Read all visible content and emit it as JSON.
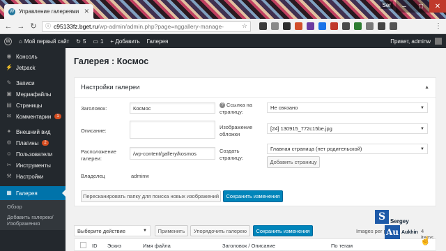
{
  "browser": {
    "tab_title": "Управление галереями",
    "url_host": "c95133fz.bget.ru",
    "url_path": "/wp-admin/admin.php?page=nggallery-manage-",
    "user_badge": "Ser",
    "extension_colors": [
      "#3a3a3a",
      "#8a8a8a",
      "#2c2c2c",
      "#d24e2a",
      "#6a3aa0",
      "#1a73e8",
      "#c0392b",
      "#4a4a4a",
      "#2e7d32",
      "#7a7a7a",
      "#444444",
      "#555555"
    ]
  },
  "adminbar": {
    "site_name": "Мой первый сайт",
    "updates_count": "5",
    "comments_count": "1",
    "add_label": "+ Добавить",
    "gallery_label": "Галерея",
    "greeting": "Привет, adminw"
  },
  "sidebar": {
    "items": [
      {
        "label": "Консоль",
        "icon": "dashboard-icon",
        "glyph": "◉"
      },
      {
        "label": "Jetpack",
        "icon": "jetpack-icon",
        "glyph": "⚡"
      },
      {
        "label": "Записи",
        "icon": "pin-icon",
        "glyph": "✎"
      },
      {
        "label": "Медиафайлы",
        "icon": "media-icon",
        "glyph": "▣"
      },
      {
        "label": "Страницы",
        "icon": "pages-icon",
        "glyph": "▤"
      },
      {
        "label": "Комментарии",
        "icon": "comments-icon",
        "glyph": "✉",
        "badge": "1"
      },
      {
        "label": "Внешний вид",
        "icon": "appearance-icon",
        "glyph": "✦"
      },
      {
        "label": "Плагины",
        "icon": "plugins-icon",
        "glyph": "⚙",
        "badge": "2"
      },
      {
        "label": "Пользователи",
        "icon": "users-icon",
        "glyph": "☺"
      },
      {
        "label": "Инструменты",
        "icon": "tools-icon",
        "glyph": "✂"
      },
      {
        "label": "Настройки",
        "icon": "settings-icon",
        "glyph": "⚒"
      }
    ],
    "active": {
      "label": "Галерея",
      "icon": "gallery-icon",
      "glyph": "▦"
    },
    "submenu": [
      "Обзор",
      "Добавить галерею/ Изображения"
    ]
  },
  "main": {
    "page_title": "Галерея : Космос",
    "settings_title": "Настройки галереи",
    "fields": {
      "title_label": "Заголовок:",
      "title_value": "Космос",
      "description_label": "Описание:",
      "description_value": "",
      "path_label": "Расположение галереи:",
      "path_value": "/wp-content/gallery/kosmos",
      "author_label": "Владелец",
      "author_value": "adminw",
      "link_label": "Ссылка на страницу:",
      "link_value": "Не связано",
      "preview_label": "Изображение обложки",
      "preview_value": "[24] 130915_772c15be.jpg",
      "create_page_label": "Создать страницу:",
      "create_page_value": "Главная страница (нет родительской)",
      "add_page_button": "Добавить страницу"
    },
    "rescan_button": "Пересканировать папку для поиска новых изображений",
    "save_button": "Сохранить изменения",
    "bulk": {
      "action_select": "Выберите действие",
      "apply_button": "Применить",
      "sort_button": "Упорядочить галерею",
      "save_button": "Сохранить изменения",
      "per_page": "Images per page",
      "count": "4 items"
    },
    "table_headers": [
      "ID",
      "Эскиз",
      "Имя файла",
      "Заголовок / Описание",
      "По тегам"
    ]
  },
  "watermark": {
    "name1": "Sergey",
    "name2": "Aukhin"
  }
}
